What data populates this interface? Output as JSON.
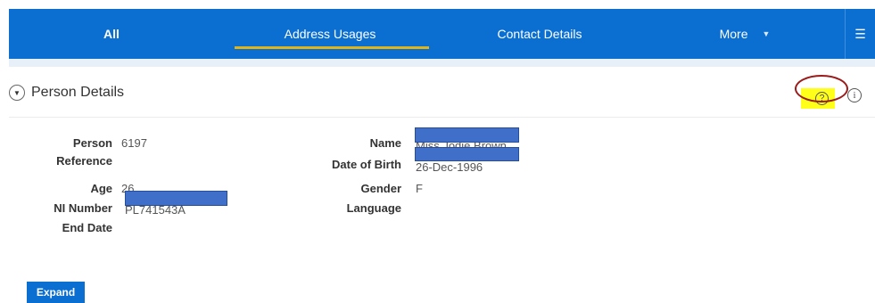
{
  "nav": {
    "tabs": [
      "All",
      "Address Usages",
      "Contact Details",
      "More"
    ],
    "menu_icon": "hamburger-icon",
    "colors": {
      "bar": "#0b6fd1",
      "active_underline": "#e2b314"
    }
  },
  "section": {
    "title": "Person Details",
    "toggle_icon": "chevron-down-icon",
    "help_icon": "question-icon",
    "info_icon": "info-icon",
    "help_glyph": "?",
    "info_glyph": "i",
    "toggle_glyph": "▼"
  },
  "fields_left": {
    "person_reference_label_1": "Person",
    "person_reference_label_2": "Reference",
    "person_reference_value": "6197",
    "age_label": "Age",
    "age_value": "26",
    "ni_label": "NI Number",
    "ni_value": "PL741543A",
    "end_date_label": "End Date"
  },
  "fields_right": {
    "name_label": "Name",
    "name_value": "Miss Jodie Brown",
    "dob_label": "Date of Birth",
    "dob_value": "26-Dec-1996",
    "gender_label": "Gender",
    "gender_value": "F",
    "language_label": "Language"
  },
  "actions": {
    "expand_label": "Expand"
  },
  "redaction_color": "#3f6fc8"
}
